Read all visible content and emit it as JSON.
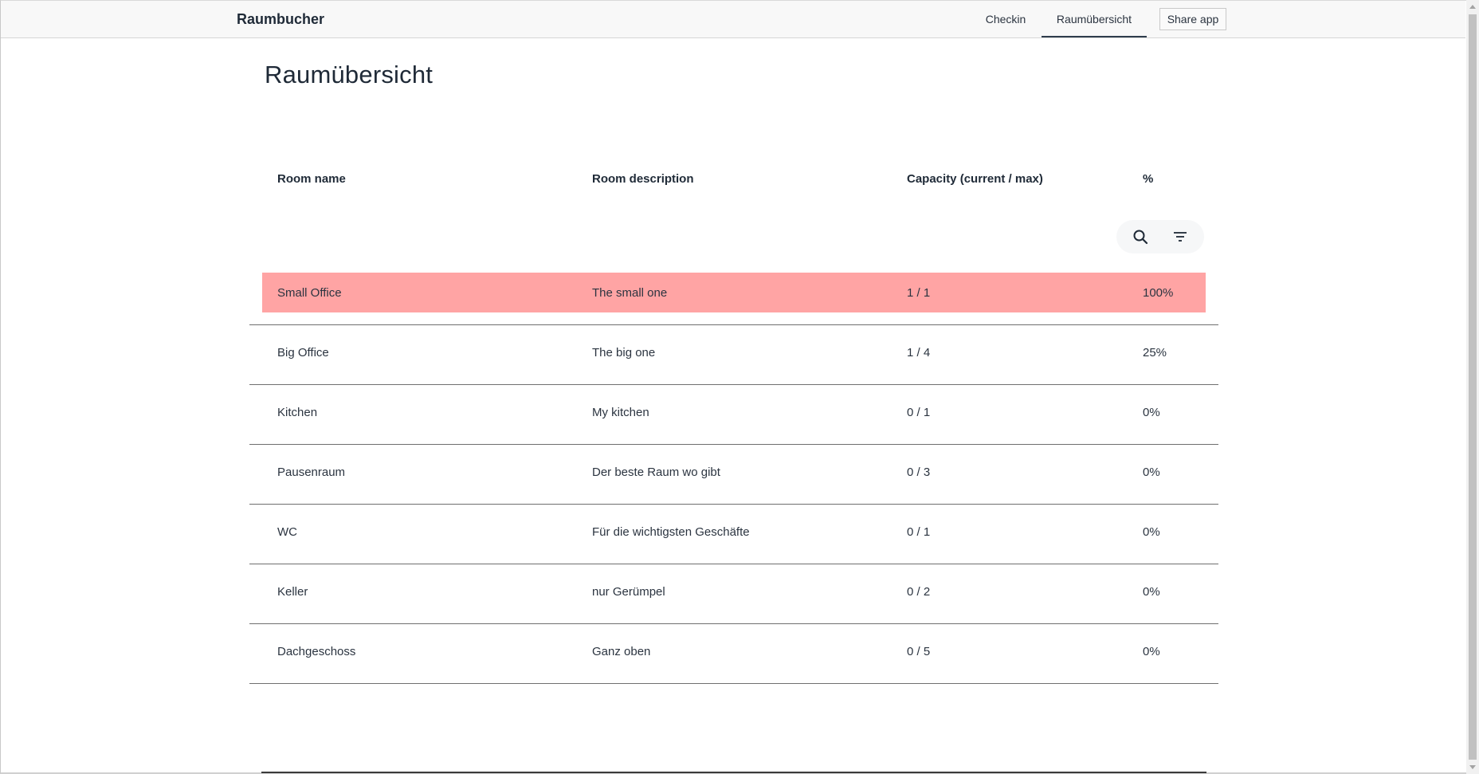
{
  "app": {
    "brand": "Raumbucher"
  },
  "nav": {
    "tabs": [
      {
        "label": "Checkin",
        "active": false
      },
      {
        "label": "Raumübersicht",
        "active": true
      }
    ],
    "share_label": "Share app"
  },
  "page": {
    "title": "Raumübersicht"
  },
  "table": {
    "headers": [
      "Room name",
      "Room description",
      "Capacity (current / max)",
      "%"
    ],
    "tools": {
      "search_icon": "search-icon",
      "filter_icon": "filter-icon"
    },
    "highlight_color": "#ffa4a4",
    "rows": [
      {
        "name": "Small Office",
        "description": "The small one",
        "capacity": "1 / 1",
        "percent": "100%",
        "highlighted": true
      },
      {
        "name": "Big Office",
        "description": "The big one",
        "capacity": "1 / 4",
        "percent": "25%",
        "highlighted": false
      },
      {
        "name": "Kitchen",
        "description": "My kitchen",
        "capacity": "0 / 1",
        "percent": "0%",
        "highlighted": false
      },
      {
        "name": "Pausenraum",
        "description": "Der beste Raum wo gibt",
        "capacity": "0 / 3",
        "percent": "0%",
        "highlighted": false
      },
      {
        "name": "WC",
        "description": "Für die wichtigsten Geschäfte",
        "capacity": "0 / 1",
        "percent": "0%",
        "highlighted": false
      },
      {
        "name": "Keller",
        "description": "nur Gerümpel",
        "capacity": "0 / 2",
        "percent": "0%",
        "highlighted": false
      },
      {
        "name": "Dachgeschoss",
        "description": "Ganz oben",
        "capacity": "0 / 5",
        "percent": "0%",
        "highlighted": false
      }
    ]
  }
}
